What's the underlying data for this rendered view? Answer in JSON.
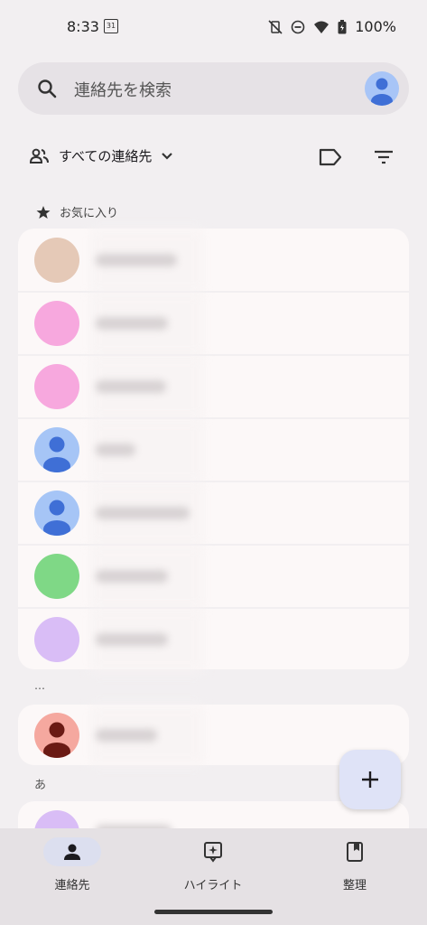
{
  "status_bar": {
    "time": "8:33",
    "calendar_day": "31",
    "battery": "100%"
  },
  "search": {
    "placeholder": "連絡先を検索"
  },
  "filter": {
    "label": "すべての連絡先"
  },
  "sections": {
    "favorites": "お気に入り",
    "misc": "…",
    "a": "あ"
  },
  "favorites": [
    {
      "avatar_color": "#e5c9b7",
      "avatar_icon": "photo"
    },
    {
      "avatar_color": "#f7a8de",
      "avatar_icon": "none"
    },
    {
      "avatar_color": "#f7a8de",
      "avatar_icon": "none"
    },
    {
      "avatar_color": "#a6c5f6",
      "avatar_icon": "person-icon"
    },
    {
      "avatar_color": "#a6c5f6",
      "avatar_icon": "person-icon"
    },
    {
      "avatar_color": "#7fd886",
      "avatar_icon": "none"
    },
    {
      "avatar_color": "#d9bdf6",
      "avatar_icon": "none"
    }
  ],
  "misc_contacts": [
    {
      "avatar_color": "#f5a89f",
      "avatar_icon": "person-icon"
    }
  ],
  "a_contacts": [
    {
      "avatar_color": "#d9bdf6",
      "avatar_icon": "partial"
    }
  ],
  "bottom_nav": {
    "items": [
      {
        "label": "連絡先",
        "icon": "person-icon",
        "active": true
      },
      {
        "label": "ハイライト",
        "icon": "highlight-icon",
        "active": false
      },
      {
        "label": "整理",
        "icon": "bookmark-icon",
        "active": false
      }
    ]
  },
  "colors": {
    "background": "#f2eff1",
    "card": "#fcf8f8",
    "fab": "#dfe3f7",
    "nav_active": "#dcdfef"
  }
}
